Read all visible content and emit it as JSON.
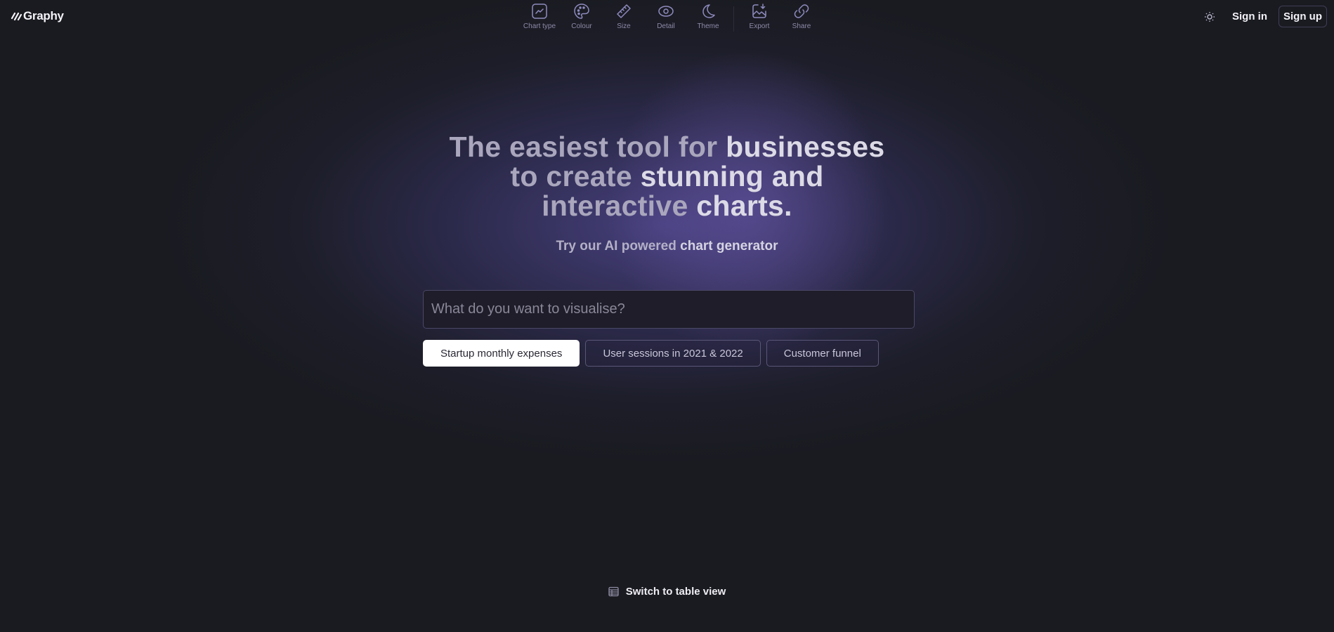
{
  "app": {
    "name": "Graphy",
    "logo_icon": "graphy-slashes-logo"
  },
  "toolbar": {
    "items": [
      {
        "label": "Chart type",
        "icon": "line-chart-icon"
      },
      {
        "label": "Colour",
        "icon": "palette-icon"
      },
      {
        "label": "Size",
        "icon": "ruler-icon"
      },
      {
        "label": "Detail",
        "icon": "eye-icon"
      },
      {
        "label": "Theme",
        "icon": "moon-icon"
      },
      {
        "label": "Export",
        "icon": "image-download-icon"
      },
      {
        "label": "Share",
        "icon": "link-icon"
      }
    ]
  },
  "nav": {
    "theme_icon": "sun-icon",
    "sign_in": "Sign in",
    "sign_up": "Sign up"
  },
  "hero": {
    "headline": {
      "line1_dim": "The easiest tool for ",
      "line1_bright": "businesses",
      "line2_dim": "to create ",
      "line2_bright": "stunning and",
      "line3_dim": "interactive ",
      "line3_bright": "charts."
    },
    "subhead": {
      "dim": "Try our AI powered ",
      "bright": "chart generator"
    },
    "prompt": {
      "placeholder": "What do you want to visualise?",
      "value": ""
    },
    "suggestions": [
      {
        "label": "Startup monthly expenses",
        "active": true
      },
      {
        "label": "User sessions in 2021 & 2022",
        "active": false
      },
      {
        "label": "Customer funnel",
        "active": false
      }
    ]
  },
  "footer": {
    "table_view_label": "Switch to table view",
    "table_view_icon": "table-icon"
  },
  "colors": {
    "background": "#1a1b21",
    "glow": "#4e468c",
    "icon_accent": "#8f8bbf",
    "chip_active_bg": "#ffffff"
  }
}
